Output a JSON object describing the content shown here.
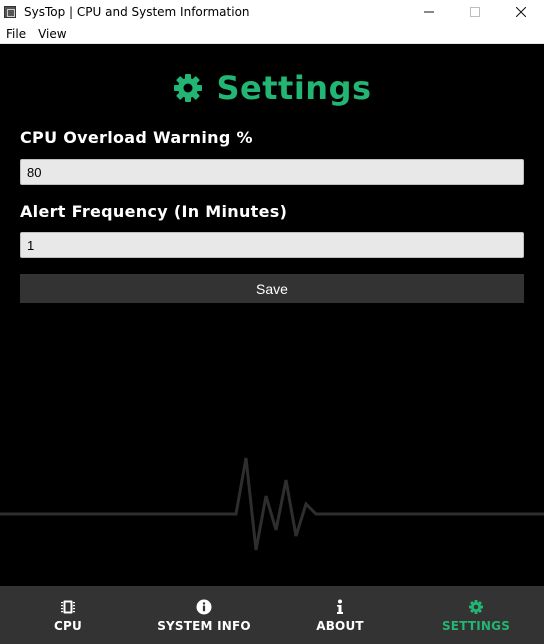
{
  "window": {
    "title": "SysTop | CPU and System Information",
    "minimize_label": "—",
    "maximize_label": "☐",
    "close_label": "✕"
  },
  "menu": {
    "items": [
      "File",
      "View"
    ]
  },
  "settings": {
    "title": "Settings",
    "cpu_overload_label": "CPU Overload Warning %",
    "cpu_overload_value": "80",
    "alert_frequency_label": "Alert Frequency (In Minutes)",
    "alert_frequency_value": "1",
    "save_label": "Save"
  },
  "nav": {
    "items": [
      {
        "label": "CPU",
        "icon": "chip-icon",
        "active": false
      },
      {
        "label": "SYSTEM INFO",
        "icon": "info-circle-icon",
        "active": false
      },
      {
        "label": "ABOUT",
        "icon": "info-icon",
        "active": false
      },
      {
        "label": "SETTINGS",
        "icon": "gear-icon",
        "active": true
      }
    ]
  },
  "colors": {
    "accent": "#22b573",
    "background": "#000000",
    "nav_background": "#333333",
    "button_background": "#333333"
  }
}
